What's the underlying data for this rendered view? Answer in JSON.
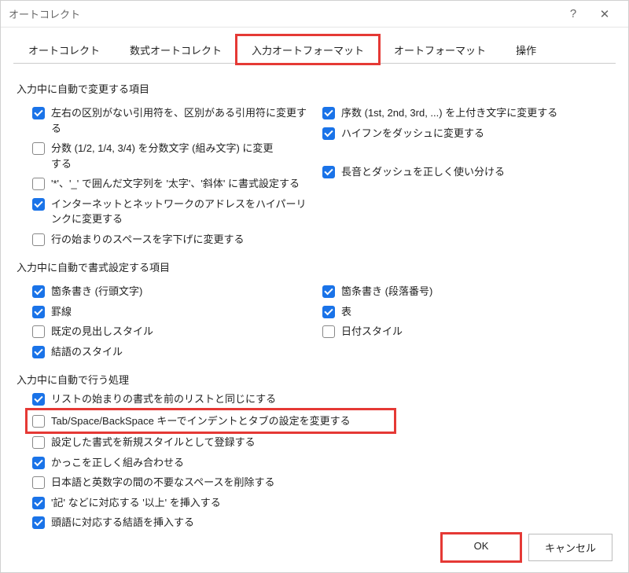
{
  "titlebar": {
    "title": "オートコレクト",
    "help": "?",
    "close": "✕"
  },
  "tabs": [
    {
      "label": "オートコレクト"
    },
    {
      "label": "数式オートコレクト"
    },
    {
      "label": "入力オートフォーマット",
      "active": true,
      "highlighted": true
    },
    {
      "label": "オートフォーマット"
    },
    {
      "label": "操作"
    }
  ],
  "section1": {
    "title": "入力中に自動で変更する項目",
    "left": [
      {
        "label": "左右の区別がない引用符を、区別がある引用符に変更する",
        "checked": true
      },
      {
        "label": "分数 (1/2, 1/4, 3/4) を分数文字 (組み文字) に変更する",
        "checked": false
      },
      {
        "label": "'*'、'_' で囲んだ文字列を '太字'、'斜体' に書式設定する",
        "checked": false
      },
      {
        "label": "インターネットとネットワークのアドレスをハイパーリンクに変更する",
        "checked": true
      },
      {
        "label": "行の始まりのスペースを字下げに変更する",
        "checked": false
      }
    ],
    "right": [
      {
        "label": "序数 (1st, 2nd, 3rd, ...) を上付き文字に変更する",
        "checked": true
      },
      {
        "label": "ハイフンをダッシュに変更する",
        "checked": true
      },
      {
        "label": "長音とダッシュを正しく使い分ける",
        "checked": true
      }
    ]
  },
  "section2": {
    "title": "入力中に自動で書式設定する項目",
    "left": [
      {
        "label": "箇条書き (行頭文字)",
        "checked": true
      },
      {
        "label": "罫線",
        "checked": true
      },
      {
        "label": "既定の見出しスタイル",
        "checked": false
      },
      {
        "label": "結語のスタイル",
        "checked": true
      }
    ],
    "right": [
      {
        "label": "箇条書き (段落番号)",
        "checked": true
      },
      {
        "label": "表",
        "checked": true
      },
      {
        "label": "日付スタイル",
        "checked": false
      }
    ]
  },
  "section3": {
    "title": "入力中に自動で行う処理",
    "items": [
      {
        "label": "リストの始まりの書式を前のリストと同じにする",
        "checked": true
      },
      {
        "label": "Tab/Space/BackSpace キーでインデントとタブの設定を変更する",
        "checked": false,
        "highlighted": true
      },
      {
        "label": "設定した書式を新規スタイルとして登録する",
        "checked": false
      },
      {
        "label": "かっこを正しく組み合わせる",
        "checked": true
      },
      {
        "label": "日本語と英数字の間の不要なスペースを削除する",
        "checked": false
      },
      {
        "label": "'記' などに対応する '以上' を挿入する",
        "checked": true
      },
      {
        "label": "頭語に対応する結語を挿入する",
        "checked": true
      }
    ]
  },
  "footer": {
    "ok": "OK",
    "cancel": "キャンセル"
  }
}
